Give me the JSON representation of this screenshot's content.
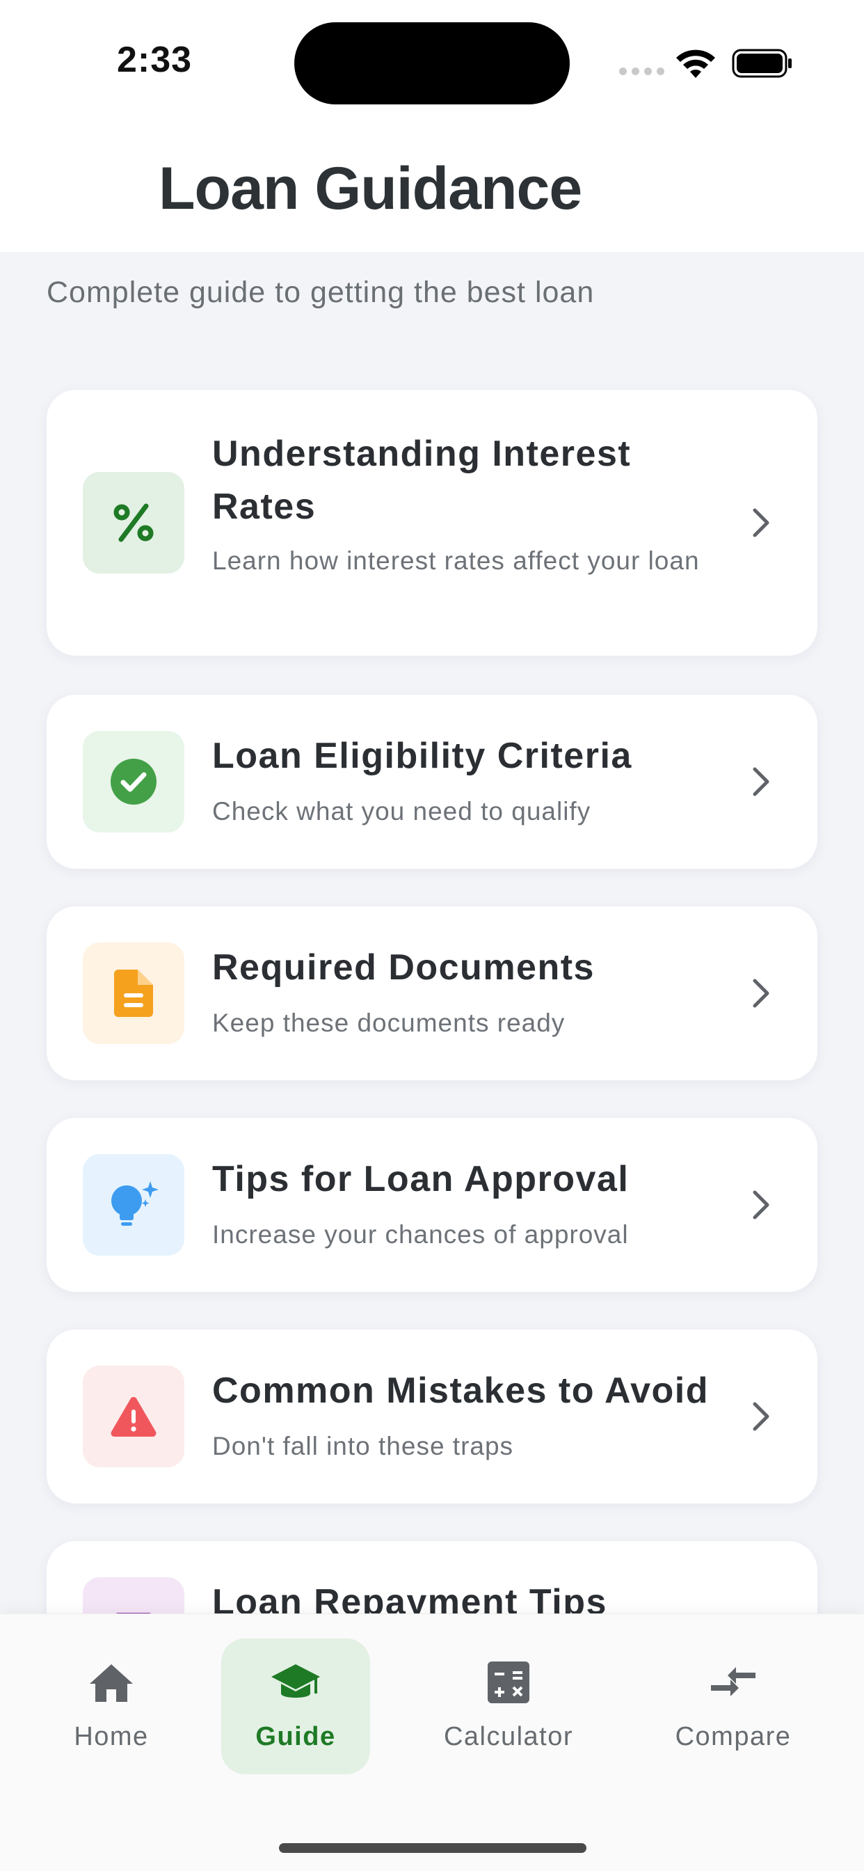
{
  "status_bar": {
    "time": "2:33"
  },
  "header": {
    "title": "Loan Guidance"
  },
  "subtitle": "Complete guide to getting the best loan",
  "cards": [
    {
      "title": "Understanding Interest Rates",
      "description": "Learn how interest rates affect your loan",
      "icon": "percent-icon",
      "icon_color": "#1e7a25",
      "icon_bg": "#e3f0e4"
    },
    {
      "title": "Loan Eligibility Criteria",
      "description": "Check what you need to qualify",
      "icon": "check-circle-icon",
      "icon_color": "#43a047",
      "icon_bg": "#e8f5e9"
    },
    {
      "title": "Required Documents",
      "description": "Keep these documents ready",
      "icon": "document-icon",
      "icon_color": "#f5a11e",
      "icon_bg": "#fff3e4"
    },
    {
      "title": "Tips for Loan Approval",
      "description": "Increase your chances of approval",
      "icon": "lightbulb-icon",
      "icon_color": "#3d9cf0",
      "icon_bg": "#e6f3fe"
    },
    {
      "title": "Common Mistakes to Avoid",
      "description": "Don't fall into these traps",
      "icon": "warning-icon",
      "icon_color": "#f0575c",
      "icon_bg": "#fdecec"
    },
    {
      "title": "Loan Repayment Tips",
      "description": "",
      "icon": "repayment-icon",
      "icon_color": "#8e3aa8",
      "icon_bg": "#f4e6f7"
    }
  ],
  "nav": {
    "items": [
      {
        "label": "Home",
        "icon": "home-icon",
        "active": false
      },
      {
        "label": "Guide",
        "icon": "graduation-cap-icon",
        "active": true
      },
      {
        "label": "Calculator",
        "icon": "calculator-icon",
        "active": false
      },
      {
        "label": "Compare",
        "icon": "compare-arrows-icon",
        "active": false
      }
    ],
    "active_color": "#1e7a25",
    "active_bg": "#e3f0e4"
  }
}
